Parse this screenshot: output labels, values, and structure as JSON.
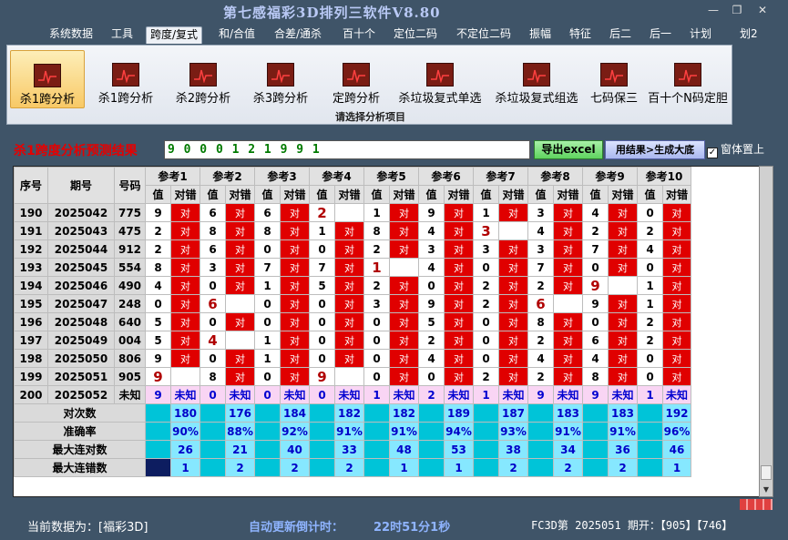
{
  "window": {
    "title": "第七感福彩3D排列三软件V8.80",
    "minimize": "—",
    "restore": "❐",
    "close": "✕"
  },
  "menu": [
    "系统数据",
    "工具",
    "跨度/复式",
    "和/合值",
    "合差/通杀",
    "百十个",
    "定位二码",
    "不定位二码",
    "振幅",
    "特征",
    "后二",
    "后一",
    "计划",
    "划2"
  ],
  "ribbon": {
    "buttons": [
      "杀1跨分析",
      "杀1跨分析",
      "杀2跨分析",
      "杀3跨分析",
      "定跨分析",
      "杀垃圾复式单选",
      "杀垃圾复式组选",
      "七码保三",
      "百十个N码定胆"
    ],
    "caption": "请选择分析项目"
  },
  "prediction": {
    "label": "杀1跨度分析预测结果",
    "value": "9 0 0 0 1 2 1 9 9 1",
    "export_button": "导出excel",
    "generate_button": "用结果>生成大底",
    "ontop_label": "窗体置上",
    "ontop_checked": "✓"
  },
  "grid": {
    "header_row1": [
      "序号",
      "期号",
      "号码",
      "参考1",
      "参考2",
      "参考3",
      "参考4",
      "参考5",
      "参考6",
      "参考7",
      "参考8",
      "参考9",
      "参考10"
    ],
    "header_row2": {
      "value": "值",
      "result": "对错"
    },
    "rows": [
      {
        "seq": "190",
        "issue": "2025042",
        "number": "775",
        "refs": [
          {
            "v": "9",
            "r": "对"
          },
          {
            "v": "6",
            "r": "对"
          },
          {
            "v": "6",
            "r": "对"
          },
          {
            "v": "2",
            "r": ""
          },
          {
            "v": "1",
            "r": "对"
          },
          {
            "v": "9",
            "r": "对"
          },
          {
            "v": "1",
            "r": "对"
          },
          {
            "v": "3",
            "r": "对"
          },
          {
            "v": "4",
            "r": "对"
          },
          {
            "v": "0",
            "r": "对"
          }
        ]
      },
      {
        "seq": "191",
        "issue": "2025043",
        "number": "475",
        "refs": [
          {
            "v": "2",
            "r": "对"
          },
          {
            "v": "8",
            "r": "对"
          },
          {
            "v": "8",
            "r": "对"
          },
          {
            "v": "1",
            "r": "对"
          },
          {
            "v": "8",
            "r": "对"
          },
          {
            "v": "4",
            "r": "对"
          },
          {
            "v": "3",
            "r": ""
          },
          {
            "v": "4",
            "r": "对"
          },
          {
            "v": "2",
            "r": "对"
          },
          {
            "v": "2",
            "r": "对"
          }
        ]
      },
      {
        "seq": "192",
        "issue": "2025044",
        "number": "912",
        "refs": [
          {
            "v": "2",
            "r": "对"
          },
          {
            "v": "6",
            "r": "对"
          },
          {
            "v": "0",
            "r": "对"
          },
          {
            "v": "0",
            "r": "对"
          },
          {
            "v": "2",
            "r": "对"
          },
          {
            "v": "3",
            "r": "对"
          },
          {
            "v": "3",
            "r": "对"
          },
          {
            "v": "3",
            "r": "对"
          },
          {
            "v": "7",
            "r": "对"
          },
          {
            "v": "4",
            "r": "对"
          }
        ]
      },
      {
        "seq": "193",
        "issue": "2025045",
        "number": "554",
        "refs": [
          {
            "v": "8",
            "r": "对"
          },
          {
            "v": "3",
            "r": "对"
          },
          {
            "v": "7",
            "r": "对"
          },
          {
            "v": "7",
            "r": "对"
          },
          {
            "v": "1",
            "r": ""
          },
          {
            "v": "4",
            "r": "对"
          },
          {
            "v": "0",
            "r": "对"
          },
          {
            "v": "7",
            "r": "对"
          },
          {
            "v": "0",
            "r": "对"
          },
          {
            "v": "0",
            "r": "对"
          }
        ]
      },
      {
        "seq": "194",
        "issue": "2025046",
        "number": "490",
        "refs": [
          {
            "v": "4",
            "r": "对"
          },
          {
            "v": "0",
            "r": "对"
          },
          {
            "v": "1",
            "r": "对"
          },
          {
            "v": "5",
            "r": "对"
          },
          {
            "v": "2",
            "r": "对"
          },
          {
            "v": "0",
            "r": "对"
          },
          {
            "v": "2",
            "r": "对"
          },
          {
            "v": "2",
            "r": "对"
          },
          {
            "v": "9",
            "r": ""
          },
          {
            "v": "1",
            "r": "对"
          }
        ]
      },
      {
        "seq": "195",
        "issue": "2025047",
        "number": "248",
        "refs": [
          {
            "v": "0",
            "r": "对"
          },
          {
            "v": "6",
            "r": ""
          },
          {
            "v": "0",
            "r": "对"
          },
          {
            "v": "0",
            "r": "对"
          },
          {
            "v": "3",
            "r": "对"
          },
          {
            "v": "9",
            "r": "对"
          },
          {
            "v": "2",
            "r": "对"
          },
          {
            "v": "6",
            "r": ""
          },
          {
            "v": "9",
            "r": "对"
          },
          {
            "v": "1",
            "r": "对"
          }
        ]
      },
      {
        "seq": "196",
        "issue": "2025048",
        "number": "640",
        "refs": [
          {
            "v": "5",
            "r": "对"
          },
          {
            "v": "0",
            "r": "对"
          },
          {
            "v": "0",
            "r": "对"
          },
          {
            "v": "0",
            "r": "对"
          },
          {
            "v": "0",
            "r": "对"
          },
          {
            "v": "5",
            "r": "对"
          },
          {
            "v": "0",
            "r": "对"
          },
          {
            "v": "8",
            "r": "对"
          },
          {
            "v": "0",
            "r": "对"
          },
          {
            "v": "2",
            "r": "对"
          }
        ]
      },
      {
        "seq": "197",
        "issue": "2025049",
        "number": "004",
        "refs": [
          {
            "v": "5",
            "r": "对"
          },
          {
            "v": "4",
            "r": ""
          },
          {
            "v": "1",
            "r": "对"
          },
          {
            "v": "0",
            "r": "对"
          },
          {
            "v": "0",
            "r": "对"
          },
          {
            "v": "2",
            "r": "对"
          },
          {
            "v": "0",
            "r": "对"
          },
          {
            "v": "2",
            "r": "对"
          },
          {
            "v": "6",
            "r": "对"
          },
          {
            "v": "2",
            "r": "对"
          }
        ]
      },
      {
        "seq": "198",
        "issue": "2025050",
        "number": "806",
        "refs": [
          {
            "v": "9",
            "r": "对"
          },
          {
            "v": "0",
            "r": "对"
          },
          {
            "v": "1",
            "r": "对"
          },
          {
            "v": "0",
            "r": "对"
          },
          {
            "v": "0",
            "r": "对"
          },
          {
            "v": "4",
            "r": "对"
          },
          {
            "v": "0",
            "r": "对"
          },
          {
            "v": "4",
            "r": "对"
          },
          {
            "v": "4",
            "r": "对"
          },
          {
            "v": "0",
            "r": "对"
          }
        ]
      },
      {
        "seq": "199",
        "issue": "2025051",
        "number": "905",
        "refs": [
          {
            "v": "9",
            "r": ""
          },
          {
            "v": "8",
            "r": "对"
          },
          {
            "v": "0",
            "r": "对"
          },
          {
            "v": "9",
            "r": ""
          },
          {
            "v": "0",
            "r": "对"
          },
          {
            "v": "0",
            "r": "对"
          },
          {
            "v": "2",
            "r": "对"
          },
          {
            "v": "2",
            "r": "对"
          },
          {
            "v": "8",
            "r": "对"
          },
          {
            "v": "0",
            "r": "对"
          }
        ]
      },
      {
        "seq": "200",
        "issue": "2025052",
        "number": "未知",
        "refs": [
          {
            "v": "9",
            "r": "未知"
          },
          {
            "v": "0",
            "r": "未知"
          },
          {
            "v": "0",
            "r": "未知"
          },
          {
            "v": "0",
            "r": "未知"
          },
          {
            "v": "1",
            "r": "未知"
          },
          {
            "v": "2",
            "r": "未知"
          },
          {
            "v": "1",
            "r": "未知"
          },
          {
            "v": "9",
            "r": "未知"
          },
          {
            "v": "9",
            "r": "未知"
          },
          {
            "v": "1",
            "r": "未知"
          }
        ]
      }
    ],
    "stats": [
      {
        "label": "对次数",
        "values": [
          "180",
          "176",
          "184",
          "182",
          "182",
          "189",
          "187",
          "183",
          "183",
          "192"
        ]
      },
      {
        "label": "准确率",
        "values": [
          "90%",
          "88%",
          "92%",
          "91%",
          "91%",
          "94%",
          "93%",
          "91%",
          "91%",
          "96%"
        ]
      },
      {
        "label": "最大连对数",
        "values": [
          "26",
          "21",
          "40",
          "33",
          "48",
          "53",
          "38",
          "34",
          "36",
          "46"
        ]
      },
      {
        "label": "最大连错数",
        "values": [
          "1",
          "2",
          "2",
          "2",
          "1",
          "1",
          "2",
          "2",
          "2",
          "1"
        ]
      }
    ]
  },
  "status": {
    "current_data": "当前数据为：[福彩3D]",
    "countdown_label": "自动更新倒计时：",
    "countdown_value": "22时51分1秒",
    "draw_info": "FC3D第 2025051 期开：【905】【746】"
  },
  "colors": {
    "hit": "#e00000",
    "stat_value": "#86e8ff",
    "future_row": "#f9d5f4",
    "titlebar": "#3f5468"
  }
}
